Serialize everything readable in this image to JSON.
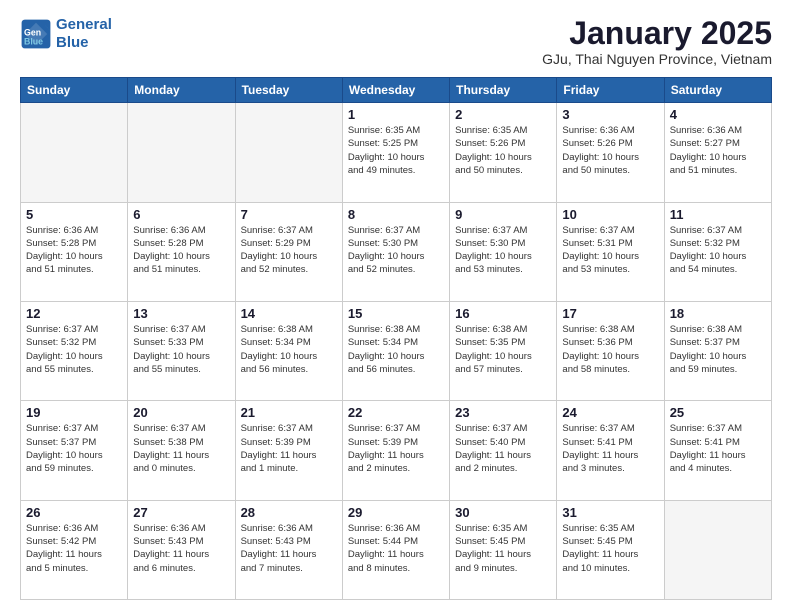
{
  "logo": {
    "line1": "General",
    "line2": "Blue"
  },
  "title": "January 2025",
  "subtitle": "GJu, Thai Nguyen Province, Vietnam",
  "days_of_week": [
    "Sunday",
    "Monday",
    "Tuesday",
    "Wednesday",
    "Thursday",
    "Friday",
    "Saturday"
  ],
  "weeks": [
    [
      {
        "day": "",
        "info": ""
      },
      {
        "day": "",
        "info": ""
      },
      {
        "day": "",
        "info": ""
      },
      {
        "day": "1",
        "info": "Sunrise: 6:35 AM\nSunset: 5:25 PM\nDaylight: 10 hours\nand 49 minutes."
      },
      {
        "day": "2",
        "info": "Sunrise: 6:35 AM\nSunset: 5:26 PM\nDaylight: 10 hours\nand 50 minutes."
      },
      {
        "day": "3",
        "info": "Sunrise: 6:36 AM\nSunset: 5:26 PM\nDaylight: 10 hours\nand 50 minutes."
      },
      {
        "day": "4",
        "info": "Sunrise: 6:36 AM\nSunset: 5:27 PM\nDaylight: 10 hours\nand 51 minutes."
      }
    ],
    [
      {
        "day": "5",
        "info": "Sunrise: 6:36 AM\nSunset: 5:28 PM\nDaylight: 10 hours\nand 51 minutes."
      },
      {
        "day": "6",
        "info": "Sunrise: 6:36 AM\nSunset: 5:28 PM\nDaylight: 10 hours\nand 51 minutes."
      },
      {
        "day": "7",
        "info": "Sunrise: 6:37 AM\nSunset: 5:29 PM\nDaylight: 10 hours\nand 52 minutes."
      },
      {
        "day": "8",
        "info": "Sunrise: 6:37 AM\nSunset: 5:30 PM\nDaylight: 10 hours\nand 52 minutes."
      },
      {
        "day": "9",
        "info": "Sunrise: 6:37 AM\nSunset: 5:30 PM\nDaylight: 10 hours\nand 53 minutes."
      },
      {
        "day": "10",
        "info": "Sunrise: 6:37 AM\nSunset: 5:31 PM\nDaylight: 10 hours\nand 53 minutes."
      },
      {
        "day": "11",
        "info": "Sunrise: 6:37 AM\nSunset: 5:32 PM\nDaylight: 10 hours\nand 54 minutes."
      }
    ],
    [
      {
        "day": "12",
        "info": "Sunrise: 6:37 AM\nSunset: 5:32 PM\nDaylight: 10 hours\nand 55 minutes."
      },
      {
        "day": "13",
        "info": "Sunrise: 6:37 AM\nSunset: 5:33 PM\nDaylight: 10 hours\nand 55 minutes."
      },
      {
        "day": "14",
        "info": "Sunrise: 6:38 AM\nSunset: 5:34 PM\nDaylight: 10 hours\nand 56 minutes."
      },
      {
        "day": "15",
        "info": "Sunrise: 6:38 AM\nSunset: 5:34 PM\nDaylight: 10 hours\nand 56 minutes."
      },
      {
        "day": "16",
        "info": "Sunrise: 6:38 AM\nSunset: 5:35 PM\nDaylight: 10 hours\nand 57 minutes."
      },
      {
        "day": "17",
        "info": "Sunrise: 6:38 AM\nSunset: 5:36 PM\nDaylight: 10 hours\nand 58 minutes."
      },
      {
        "day": "18",
        "info": "Sunrise: 6:38 AM\nSunset: 5:37 PM\nDaylight: 10 hours\nand 59 minutes."
      }
    ],
    [
      {
        "day": "19",
        "info": "Sunrise: 6:37 AM\nSunset: 5:37 PM\nDaylight: 10 hours\nand 59 minutes."
      },
      {
        "day": "20",
        "info": "Sunrise: 6:37 AM\nSunset: 5:38 PM\nDaylight: 11 hours\nand 0 minutes."
      },
      {
        "day": "21",
        "info": "Sunrise: 6:37 AM\nSunset: 5:39 PM\nDaylight: 11 hours\nand 1 minute."
      },
      {
        "day": "22",
        "info": "Sunrise: 6:37 AM\nSunset: 5:39 PM\nDaylight: 11 hours\nand 2 minutes."
      },
      {
        "day": "23",
        "info": "Sunrise: 6:37 AM\nSunset: 5:40 PM\nDaylight: 11 hours\nand 2 minutes."
      },
      {
        "day": "24",
        "info": "Sunrise: 6:37 AM\nSunset: 5:41 PM\nDaylight: 11 hours\nand 3 minutes."
      },
      {
        "day": "25",
        "info": "Sunrise: 6:37 AM\nSunset: 5:41 PM\nDaylight: 11 hours\nand 4 minutes."
      }
    ],
    [
      {
        "day": "26",
        "info": "Sunrise: 6:36 AM\nSunset: 5:42 PM\nDaylight: 11 hours\nand 5 minutes."
      },
      {
        "day": "27",
        "info": "Sunrise: 6:36 AM\nSunset: 5:43 PM\nDaylight: 11 hours\nand 6 minutes."
      },
      {
        "day": "28",
        "info": "Sunrise: 6:36 AM\nSunset: 5:43 PM\nDaylight: 11 hours\nand 7 minutes."
      },
      {
        "day": "29",
        "info": "Sunrise: 6:36 AM\nSunset: 5:44 PM\nDaylight: 11 hours\nand 8 minutes."
      },
      {
        "day": "30",
        "info": "Sunrise: 6:35 AM\nSunset: 5:45 PM\nDaylight: 11 hours\nand 9 minutes."
      },
      {
        "day": "31",
        "info": "Sunrise: 6:35 AM\nSunset: 5:45 PM\nDaylight: 11 hours\nand 10 minutes."
      },
      {
        "day": "",
        "info": ""
      }
    ]
  ]
}
